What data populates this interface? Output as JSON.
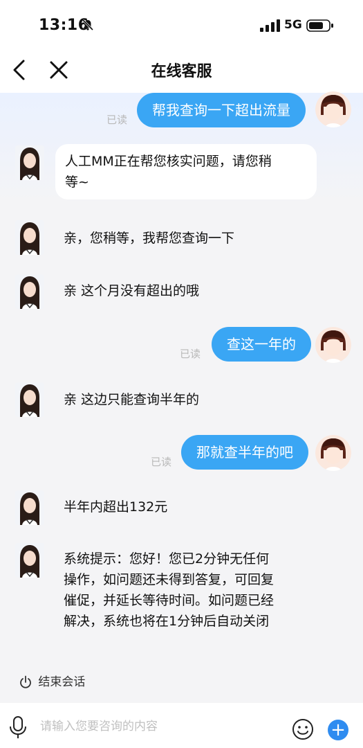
{
  "status_bar": {
    "time": "13:16",
    "network": "5G",
    "icons": [
      "bell-muted-icon",
      "signal-icon",
      "battery-icon"
    ]
  },
  "header": {
    "title": "在线客服",
    "back_icon": "chevron-left-icon",
    "close_icon": "close-icon"
  },
  "messages": [
    {
      "from": "user",
      "text": "帮我查询一下超出流量",
      "read": "已读"
    },
    {
      "from": "agent",
      "lines": [
        "人工MM正在帮您核实问题，请您稍",
        "等~"
      ]
    },
    {
      "from": "agent",
      "text": "亲，您稍等，我帮您查询一下"
    },
    {
      "from": "agent",
      "text": "亲 这个月没有超出的哦"
    },
    {
      "from": "user",
      "text": "查这一年的",
      "read": "已读"
    },
    {
      "from": "agent",
      "text": "亲 这边只能查询半年的"
    },
    {
      "from": "user",
      "text": "那就查半年的吧",
      "read": "已读"
    },
    {
      "from": "agent",
      "text": "半年内超出132元"
    },
    {
      "from": "agent",
      "lines": [
        "系统提示：您好！您已2分钟无任何",
        "操作，如问题还未得到答复，可回复",
        "催促，并延长等待时间。如问题已经",
        "解决，系统也将在1分钟后自动关闭"
      ]
    }
  ],
  "end_session": {
    "label": "结束会话",
    "icon": "power-icon"
  },
  "input_bar": {
    "placeholder": "请输入您要咨询的内容",
    "value": "",
    "mic_icon": "microphone-icon",
    "emoji_icon": "emoji-icon",
    "plus_label": "+"
  },
  "colors": {
    "user_bubble": "#3aa6f4",
    "read_text": "#b8b8b8",
    "plus_button": "#2f8cf0"
  }
}
